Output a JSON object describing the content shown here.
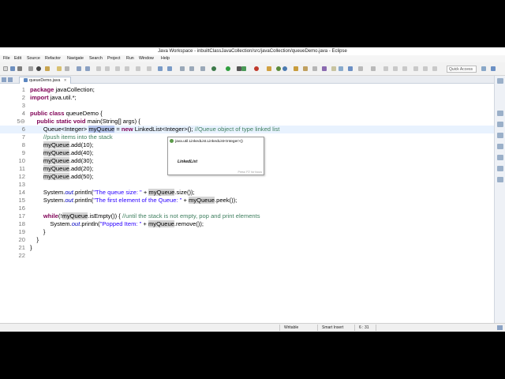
{
  "window": {
    "title": "Java Workspace - inbuiltClassJavaCollection/src/javaCollection/queueDemo.java - Eclipse"
  },
  "menu": [
    "File",
    "Edit",
    "Source",
    "Refactor",
    "Navigate",
    "Search",
    "Project",
    "Run",
    "Window",
    "Help"
  ],
  "toolbar": {
    "quick_access_placeholder": "Quick Access"
  },
  "tab": {
    "label": "queueDemo.java",
    "close": "✕"
  },
  "code": [
    {
      "n": "1",
      "text": "package javaCollection;"
    },
    {
      "n": "2",
      "text": "import java.util.*;"
    },
    {
      "n": "3",
      "text": ""
    },
    {
      "n": "4",
      "text": "public class queueDemo {"
    },
    {
      "n": "5⊖",
      "text": "    public static void main(String[] args) {"
    },
    {
      "n": "6",
      "text": "        Queue<Integer> myQueue = new LinkedList<Integer>(); //Queue object of type linked list"
    },
    {
      "n": "7",
      "text": "        //push items into the stack"
    },
    {
      "n": "8",
      "text": "        myQueue.add(10);"
    },
    {
      "n": "9",
      "text": "        myQueue.add(40);"
    },
    {
      "n": "10",
      "text": "        myQueue.add(30);"
    },
    {
      "n": "11",
      "text": "        myQueue.add(20);"
    },
    {
      "n": "12",
      "text": "        myQueue.add(50);"
    },
    {
      "n": "13",
      "text": ""
    },
    {
      "n": "14",
      "text": "        System.out.println(\"The queue size: \" + myQueue.size());"
    },
    {
      "n": "15",
      "text": "        System.out.println(\"The first element of the Queue: \" + myQueue.peek());"
    },
    {
      "n": "16",
      "text": ""
    },
    {
      "n": "17",
      "text": "        while(!myQueue.isEmpty()) { //until the stack is not empty, pop and print elements"
    },
    {
      "n": "18",
      "text": "            System.out.println(\"Popped Item: \" + myQueue.remove());"
    },
    {
      "n": "19",
      "text": "        }"
    },
    {
      "n": "20",
      "text": "    }"
    },
    {
      "n": "21",
      "text": "}"
    },
    {
      "n": "22",
      "text": ""
    }
  ],
  "autocomplete": {
    "item": "java.util.LinkedList.LinkedList<Integer>()",
    "description": "LinkedList",
    "hint": "Press 'F2' for focus"
  },
  "status": {
    "writable": "Writable",
    "insert_mode": "Smart Insert",
    "position": "6 : 31"
  },
  "colors": {
    "keyword": "#7f0055",
    "string": "#2a00ff",
    "comment": "#3f7f5f",
    "field": "#0000c0",
    "current_line": "#e8f2fe",
    "occurrence": "#d4d4d4"
  }
}
